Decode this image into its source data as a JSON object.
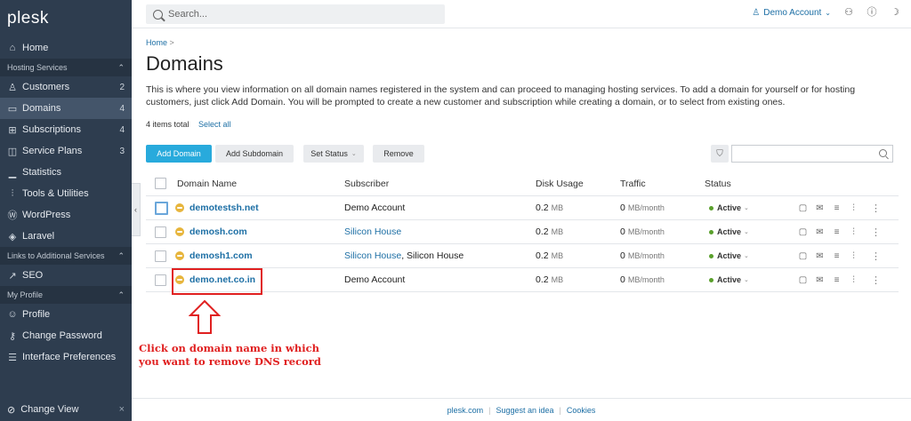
{
  "app": {
    "logo": "plesk"
  },
  "search": {
    "placeholder": "Search..."
  },
  "topbar": {
    "account": "Demo Account"
  },
  "sidebar": {
    "home": "Home",
    "sections": {
      "hosting": "Hosting Services",
      "links": "Links to Additional Services",
      "profile": "My Profile"
    },
    "hosting_items": [
      {
        "label": "Customers",
        "count": "2"
      },
      {
        "label": "Domains",
        "count": "4"
      },
      {
        "label": "Subscriptions",
        "count": "4"
      },
      {
        "label": "Service Plans",
        "count": "3"
      }
    ],
    "other_items": [
      "Statistics",
      "Tools & Utilities",
      "WordPress",
      "Laravel"
    ],
    "links_items": [
      "SEO"
    ],
    "profile_items": [
      "Profile",
      "Change Password",
      "Interface Preferences"
    ],
    "change_view": "Change View"
  },
  "main": {
    "breadcrumb": "Home",
    "title": "Domains",
    "description": "This is where you view information on all domain names registered in the system and can proceed to managing hosting services. To add a domain for yourself or for hosting customers, just click Add Domain. You will be prompted to create a new customer and subscription while creating a domain, or to select from existing ones.",
    "items_total": "4 items total",
    "select_all": "Select all"
  },
  "toolbar": {
    "add_domain": "Add Domain",
    "add_subdomain": "Add Subdomain",
    "set_status": "Set Status",
    "remove": "Remove"
  },
  "table": {
    "headers": [
      "Domain Name",
      "Subscriber",
      "Disk Usage",
      "Traffic",
      "Status"
    ],
    "rows": [
      {
        "domain": "demotestsh.net",
        "subscriber": "Demo Account",
        "subscriber_extra": "",
        "subscriber_link": false,
        "disk": "0.2",
        "disk_unit": "MB",
        "traffic": "0",
        "traffic_unit": "MB/month",
        "status": "Active"
      },
      {
        "domain": "demosh.com",
        "subscriber": "Silicon House",
        "subscriber_extra": "",
        "subscriber_link": true,
        "disk": "0.2",
        "disk_unit": "MB",
        "traffic": "0",
        "traffic_unit": "MB/month",
        "status": "Active"
      },
      {
        "domain": "demosh1.com",
        "subscriber": "Silicon House",
        "subscriber_extra": ", Silicon House",
        "subscriber_link": true,
        "disk": "0.2",
        "disk_unit": "MB",
        "traffic": "0",
        "traffic_unit": "MB/month",
        "status": "Active"
      },
      {
        "domain": "demo.net.co.in",
        "subscriber": "Demo Account",
        "subscriber_extra": "",
        "subscriber_link": false,
        "disk": "0.2",
        "disk_unit": "MB",
        "traffic": "0",
        "traffic_unit": "MB/month",
        "status": "Active"
      }
    ]
  },
  "annotation": {
    "line1": "Click on domain name in which",
    "line2": "you want to remove DNS record"
  },
  "footer": {
    "links": [
      "plesk.com",
      "Suggest an idea",
      "Cookies"
    ]
  },
  "colors": {
    "sidebar": "#2e3d4f",
    "accent": "#28aadc",
    "link": "#1d6fa5",
    "annotation": "#e02020"
  }
}
